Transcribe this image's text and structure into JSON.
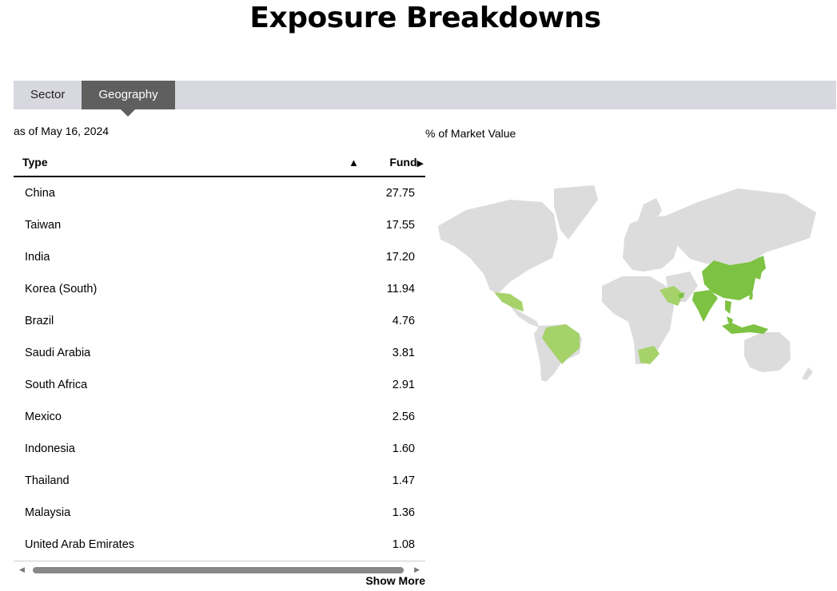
{
  "page": {
    "title": "Exposure Breakdowns"
  },
  "tabs": [
    {
      "label": "Sector",
      "active": false
    },
    {
      "label": "Geography",
      "active": true
    }
  ],
  "as_of": "as of May 16, 2024",
  "map_label": "% of Market Value",
  "table": {
    "columns": {
      "type": "Type",
      "fund": "Fund"
    },
    "sort_indicator": "▲",
    "fund_arrow": "▶",
    "rows": [
      {
        "name": "China",
        "value": "27.75"
      },
      {
        "name": "Taiwan",
        "value": "17.55"
      },
      {
        "name": "India",
        "value": "17.20"
      },
      {
        "name": "Korea (South)",
        "value": "11.94"
      },
      {
        "name": "Brazil",
        "value": "4.76"
      },
      {
        "name": "Saudi Arabia",
        "value": "3.81"
      },
      {
        "name": "South Africa",
        "value": "2.91"
      },
      {
        "name": "Mexico",
        "value": "2.56"
      },
      {
        "name": "Indonesia",
        "value": "1.60"
      },
      {
        "name": "Thailand",
        "value": "1.47"
      },
      {
        "name": "Malaysia",
        "value": "1.36"
      },
      {
        "name": "United Arab Emirates",
        "value": "1.08"
      }
    ]
  },
  "show_more": "Show More",
  "colors": {
    "tab_active": "#5f5f5f",
    "tab_bar": "#d8d8e0",
    "map_land": "#dcdcdc",
    "map_highlight_strong": "#7dc242",
    "map_highlight_light": "#a6d26a"
  },
  "icons": {
    "scroll_left": "scroll-left-icon",
    "scroll_right": "scroll-right-icon"
  }
}
